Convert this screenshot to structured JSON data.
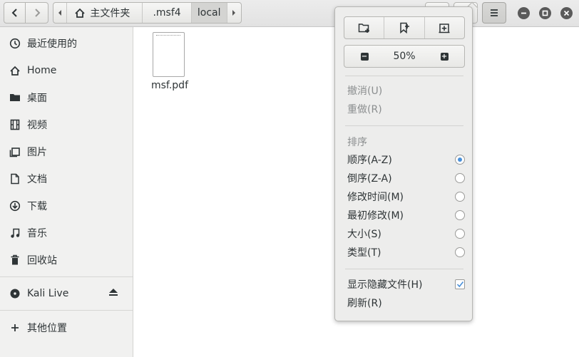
{
  "pathbar": {
    "home_label": "主文件夹",
    "crumbs": [
      ".msf4",
      "local"
    ]
  },
  "sidebar": {
    "items": [
      {
        "label": "最近使用的",
        "icon": "clock-icon"
      },
      {
        "label": "Home",
        "icon": "home-icon"
      },
      {
        "label": "桌面",
        "icon": "folder-icon"
      },
      {
        "label": "视频",
        "icon": "film-icon"
      },
      {
        "label": "图片",
        "icon": "image-icon"
      },
      {
        "label": "文档",
        "icon": "document-icon"
      },
      {
        "label": "下载",
        "icon": "download-icon"
      },
      {
        "label": "音乐",
        "icon": "music-icon"
      },
      {
        "label": "回收站",
        "icon": "trash-icon"
      }
    ],
    "device": {
      "label": "Kali Live",
      "icon": "disc-icon"
    },
    "other": {
      "label": "其他位置",
      "icon": "plus-icon"
    }
  },
  "files": [
    {
      "name": "msf.pdf",
      "icon": "pdf-file-icon"
    }
  ],
  "menu": {
    "zoom": "50%",
    "undo": "撤消(U)",
    "redo": "重做(R)",
    "sort_header": "排序",
    "sort_options": [
      {
        "label": "顺序(A-Z)",
        "selected": true
      },
      {
        "label": "倒序(Z-A)",
        "selected": false
      },
      {
        "label": "修改时间(M)",
        "selected": false
      },
      {
        "label": "最初修改(M)",
        "selected": false
      },
      {
        "label": "大小(S)",
        "selected": false
      },
      {
        "label": "类型(T)",
        "selected": false
      }
    ],
    "show_hidden": "显示隐藏文件(H)",
    "show_hidden_checked": true,
    "refresh": "刷新(R)"
  },
  "colors": {
    "accent": "#4a90d9",
    "sidebar_bg": "#f1f1f0",
    "header_bg": "#e6e6e4"
  }
}
